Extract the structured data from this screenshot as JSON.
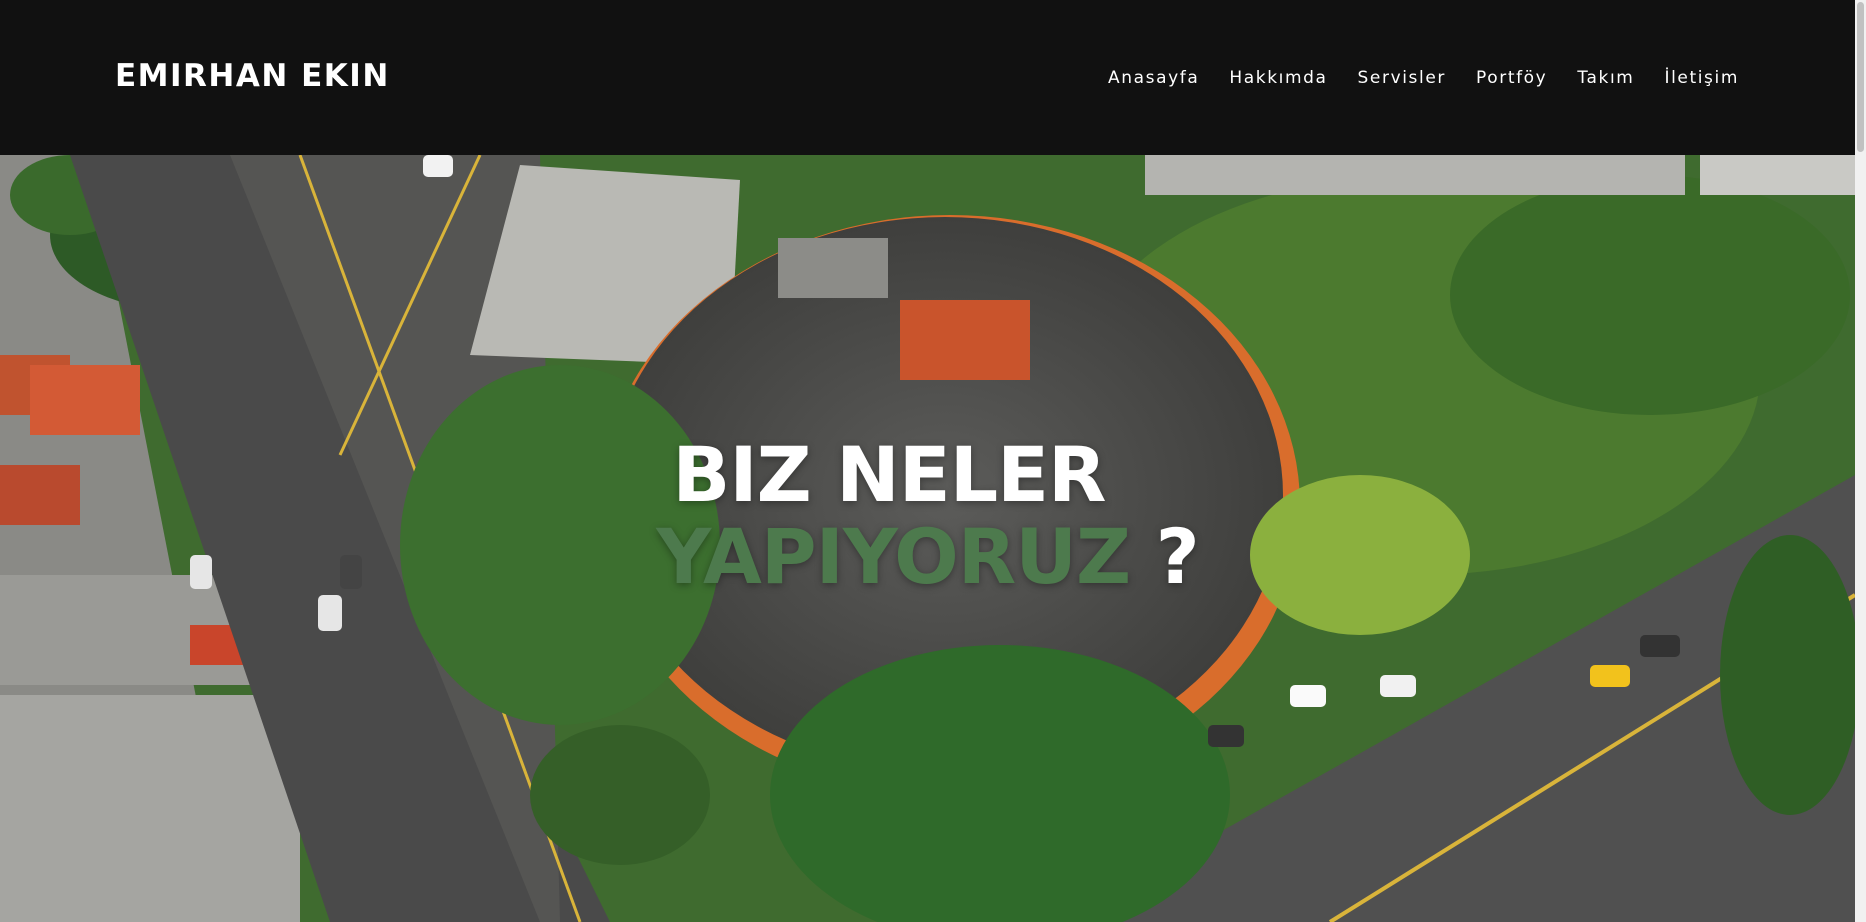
{
  "header": {
    "brand": "EMIRHAN EKIN",
    "nav": [
      {
        "label": "Anasayfa"
      },
      {
        "label": "Hakkımda"
      },
      {
        "label": "Servisler"
      },
      {
        "label": "Portföy"
      },
      {
        "label": "Takım"
      },
      {
        "label": "İletişim"
      }
    ]
  },
  "hero": {
    "line1": "BIZ NELER",
    "line2": "YAPIYORUZ",
    "line2_suffix": " ?"
  },
  "colors": {
    "navbar_bg": "#111111",
    "accent_green": "#4d7a4d"
  }
}
